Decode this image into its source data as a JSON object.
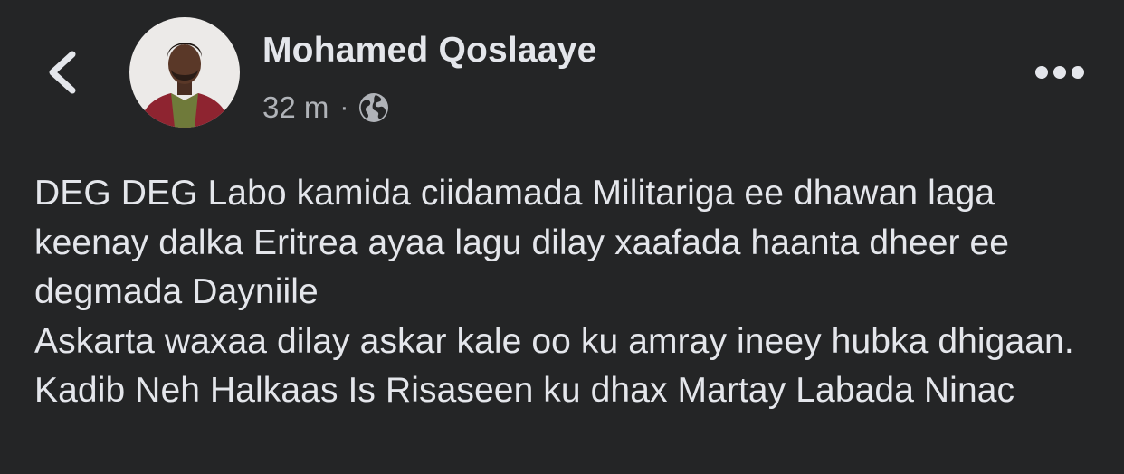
{
  "header": {
    "back_icon": "chevron-left-icon",
    "author_name": "Mohamed Qoslaaye",
    "timestamp": "32 m",
    "separator": "·",
    "privacy_icon": "globe-icon",
    "more_icon": "more-horizontal-icon"
  },
  "post": {
    "text": "DEG DEG Labo kamida ciidamada Militariga ee dhawan laga keenay dalka Eritrea ayaa lagu dilay xaafada haanta dheer ee degmada Dayniile\nAskarta waxaa dilay askar kale oo ku amray ineey hubka dhigaan. Kadib Neh Halkaas Is Risaseen ku dhax Martay Labada Ninac"
  },
  "colors": {
    "background": "#242526",
    "primary_text": "#e4e6eb",
    "secondary_text": "#b0b3b8"
  }
}
